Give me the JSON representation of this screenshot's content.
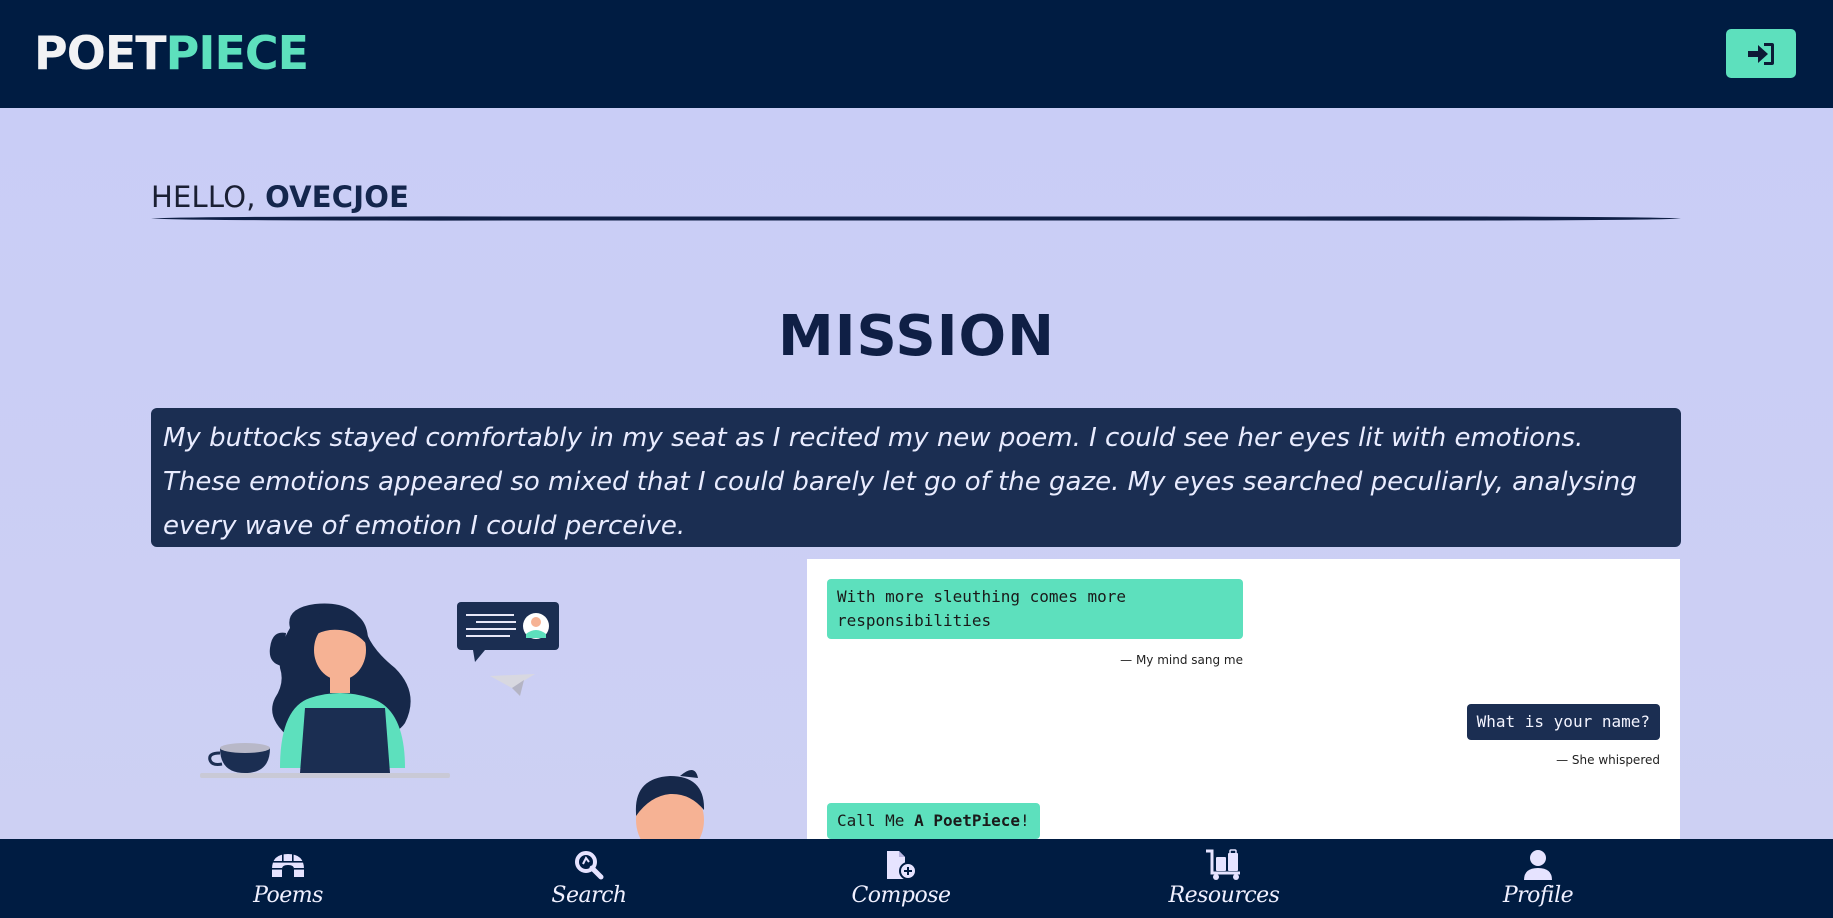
{
  "app": {
    "logo_part1": "POET",
    "logo_part2": "PIECE"
  },
  "header": {
    "login_icon": "sign-in-icon"
  },
  "greeting": {
    "prefix": "HELLO, ",
    "username": "OVECJOE"
  },
  "mission": {
    "title": "MISSION",
    "text": "My buttocks stayed comfortably in my seat as I recited my new poem. I could see her eyes lit with emotions. These emotions appeared so mixed that I could barely let go of the gaze. My eyes searched peculiarly, analysing every wave of emotion I could perceive."
  },
  "chat": {
    "message1": "With more sleuthing comes more responsibilities",
    "caption1": "— My mind sang me",
    "message2": "What is your name?",
    "caption2": "— She whispered",
    "message3_prefix": "Call Me ",
    "message3_bold": "A PoetPiece",
    "message3_suffix": "!"
  },
  "nav": {
    "items": [
      {
        "label": "Poems",
        "icon": "igloo-icon"
      },
      {
        "label": "Search",
        "icon": "search-icon"
      },
      {
        "label": "Compose",
        "icon": "file-add-icon"
      },
      {
        "label": "Resources",
        "icon": "luggage-cart-icon"
      },
      {
        "label": "Profile",
        "icon": "user-icon"
      }
    ]
  },
  "colors": {
    "navy": "#001c42",
    "accent": "#5de0bd",
    "background": "#cbcff5",
    "mission_box": "#1b2e52"
  }
}
